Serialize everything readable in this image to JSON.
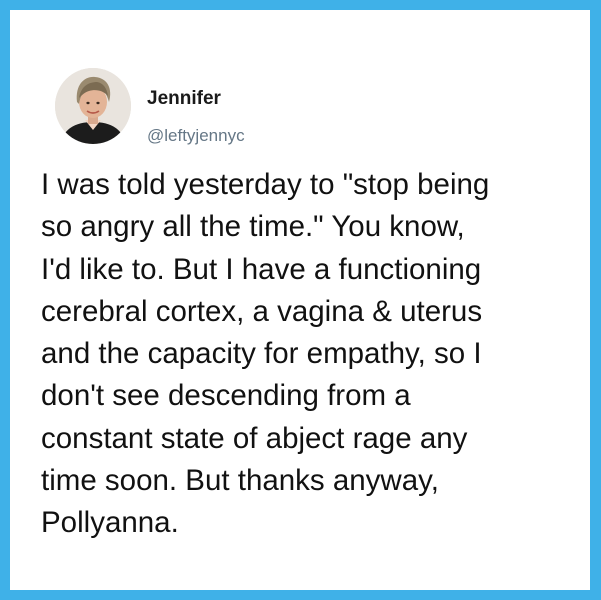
{
  "tweet": {
    "author_name": "Jennifer",
    "handle": "@leftyjennyc",
    "lines": [
      "I was told yesterday to \"stop being",
      "so angry all the time.\" You know,",
      "I'd like to. But I have a functioning",
      "cerebral cortex, a vagina & uterus",
      "and the capacity for empathy, so I",
      "don't see descending from a",
      "constant state of abject rage any",
      "time soon. But thanks anyway,",
      "Pollyanna."
    ]
  },
  "colors": {
    "border": "#3fb1e8",
    "card": "#ffffff",
    "handle": "#657786"
  }
}
